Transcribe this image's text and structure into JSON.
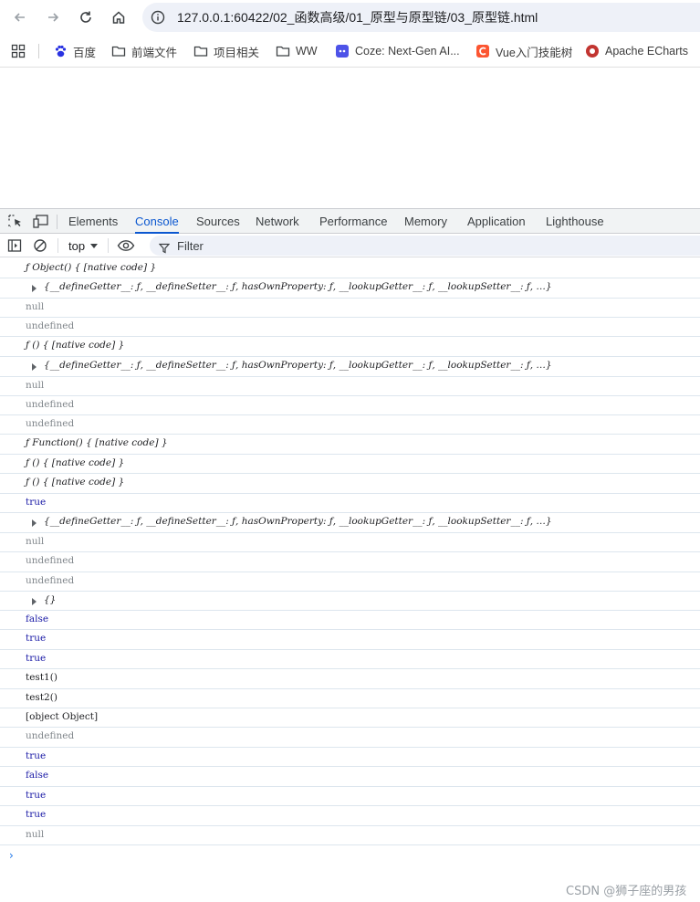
{
  "browser": {
    "url": "127.0.0.1:60422/02_函数高级/01_原型与原型链/03_原型链.html",
    "bookmarks": [
      {
        "label": "百度",
        "icon": "baidu-paw-icon"
      },
      {
        "label": "前端文件",
        "icon": "folder-icon"
      },
      {
        "label": "项目相关",
        "icon": "folder-icon"
      },
      {
        "label": "WW",
        "icon": "folder-icon"
      },
      {
        "label": "Coze: Next-Gen AI...",
        "icon": "coze-icon"
      },
      {
        "label": "Vue入门技能树",
        "icon": "csdn-icon"
      },
      {
        "label": "Apache ECharts",
        "icon": "echarts-icon"
      }
    ]
  },
  "devtools": {
    "tabs": [
      "Elements",
      "Console",
      "Sources",
      "Network",
      "Performance",
      "Memory",
      "Application",
      "Lighthouse"
    ],
    "active_tab": "Console",
    "context": "top",
    "filter_placeholder": "Filter"
  },
  "console": {
    "lines": [
      {
        "text": "ƒ Object() { [native code] }",
        "kind": "func"
      },
      {
        "text": "{__defineGetter__: ƒ, __defineSetter__: ƒ, hasOwnProperty: ƒ, __lookupGetter__: ƒ, __lookupSetter__: ƒ, …}",
        "kind": "obj",
        "expandable": true
      },
      {
        "text": "null",
        "kind": "null"
      },
      {
        "text": "undefined",
        "kind": "undef"
      },
      {
        "text": "ƒ () { [native code] }",
        "kind": "func"
      },
      {
        "text": "{__defineGetter__: ƒ, __defineSetter__: ƒ, hasOwnProperty: ƒ, __lookupGetter__: ƒ, __lookupSetter__: ƒ, …}",
        "kind": "obj",
        "expandable": true
      },
      {
        "text": "null",
        "kind": "null"
      },
      {
        "text": "undefined",
        "kind": "undef"
      },
      {
        "text": "undefined",
        "kind": "undef"
      },
      {
        "text": "ƒ Function() { [native code] }",
        "kind": "func"
      },
      {
        "text": "ƒ () { [native code] }",
        "kind": "func"
      },
      {
        "text": "ƒ () { [native code] }",
        "kind": "func"
      },
      {
        "text": "true",
        "kind": "bool"
      },
      {
        "text": "{__defineGetter__: ƒ, __defineSetter__: ƒ, hasOwnProperty: ƒ, __lookupGetter__: ƒ, __lookupSetter__: ƒ, …}",
        "kind": "obj",
        "expandable": true
      },
      {
        "text": "null",
        "kind": "null"
      },
      {
        "text": "undefined",
        "kind": "undef"
      },
      {
        "text": "undefined",
        "kind": "undef"
      },
      {
        "text": "{}",
        "kind": "obj",
        "expandable": true
      },
      {
        "text": "false",
        "kind": "bool"
      },
      {
        "text": "true",
        "kind": "bool"
      },
      {
        "text": "true",
        "kind": "bool"
      },
      {
        "text": "test1()",
        "kind": "str"
      },
      {
        "text": "test2()",
        "kind": "str"
      },
      {
        "text": "[object Object]",
        "kind": "str"
      },
      {
        "text": "undefined",
        "kind": "undef"
      },
      {
        "text": "true",
        "kind": "bool"
      },
      {
        "text": "false",
        "kind": "bool"
      },
      {
        "text": "true",
        "kind": "bool"
      },
      {
        "text": "true",
        "kind": "bool"
      },
      {
        "text": "null",
        "kind": "null"
      }
    ],
    "prompt": "›"
  },
  "watermark": "CSDN @狮子座的男孩"
}
